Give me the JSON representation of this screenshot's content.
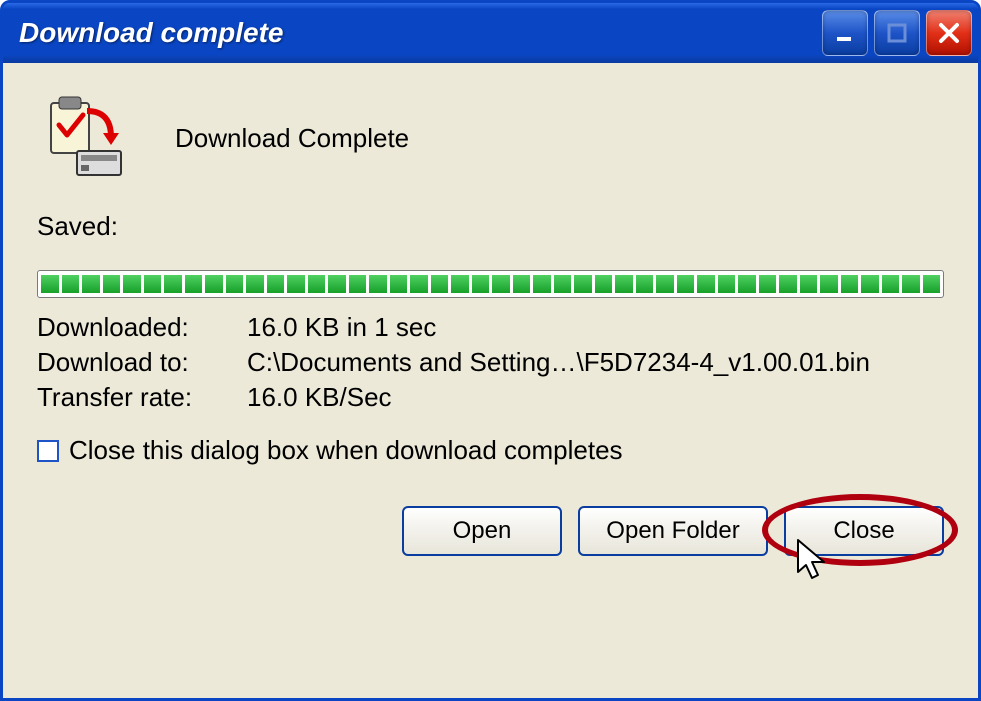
{
  "window": {
    "title": "Download complete"
  },
  "header": {
    "message": "Download Complete"
  },
  "labels": {
    "saved": "Saved:",
    "downloaded": "Downloaded:",
    "download_to": "Download to:",
    "transfer_rate": "Transfer rate:",
    "close_checkbox": "Close this dialog box when download completes"
  },
  "values": {
    "downloaded": "16.0 KB in 1 sec",
    "download_to": "C:\\Documents and Setting…\\F5D7234-4_v1.00.01.bin",
    "transfer_rate": "16.0 KB/Sec"
  },
  "checkbox": {
    "close_checked": false
  },
  "buttons": {
    "open": "Open",
    "open_folder": "Open Folder",
    "close": "Close"
  },
  "progress": {
    "segments": 44,
    "complete": true
  }
}
